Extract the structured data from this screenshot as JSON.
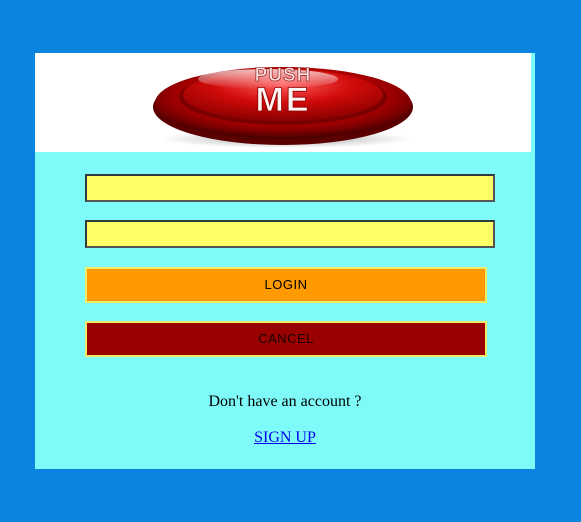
{
  "logo": {
    "line1": "PUSH",
    "line2": "ME",
    "icon": "red-push-button-logo"
  },
  "form": {
    "username": {
      "value": "",
      "placeholder": ""
    },
    "password": {
      "value": "",
      "placeholder": ""
    },
    "login_label": "LOGIN",
    "cancel_label": "CANCEL"
  },
  "footer": {
    "question": "Don't have an account ?",
    "signup_label": "SIGN UP"
  },
  "colors": {
    "page_background": "#0b84e0",
    "card_background": "#7efbf8",
    "header_background": "#ffffff",
    "input_background": "#ffff66",
    "login_button": "#ff9900",
    "cancel_button": "#990000",
    "link": "#0000ee"
  }
}
